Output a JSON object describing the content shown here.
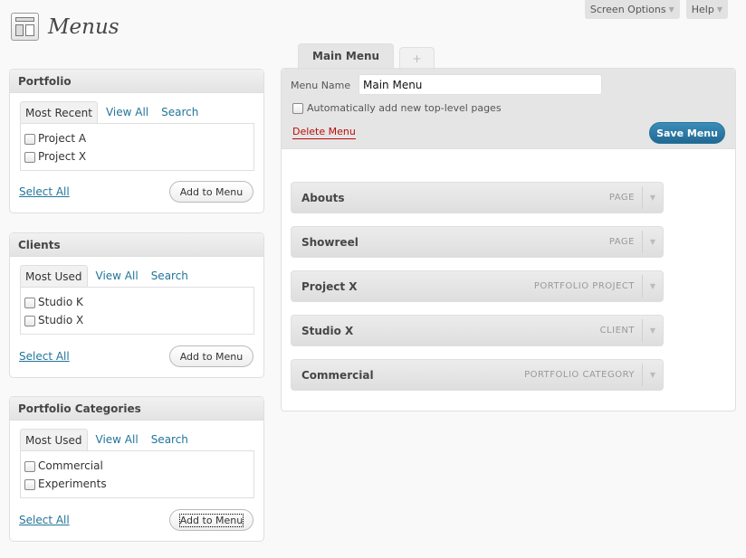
{
  "top": {
    "screen_options": "Screen Options",
    "help": "Help"
  },
  "page": {
    "title": "Menus"
  },
  "boxes": [
    {
      "title": "Portfolio",
      "tabs": [
        "Most Recent",
        "View All",
        "Search"
      ],
      "items": [
        "Project A",
        "Project X"
      ],
      "select_all": "Select All",
      "add_button": "Add to Menu"
    },
    {
      "title": "Clients",
      "tabs": [
        "Most Used",
        "View All",
        "Search"
      ],
      "items": [
        "Studio K",
        "Studio X"
      ],
      "select_all": "Select All",
      "add_button": "Add to Menu"
    },
    {
      "title": "Portfolio Categories",
      "tabs": [
        "Most Used",
        "View All",
        "Search"
      ],
      "items": [
        "Commercial",
        "Experiments"
      ],
      "select_all": "Select All",
      "add_button": "Add to Menu"
    }
  ],
  "editor": {
    "active_tab": "Main Menu",
    "add_tab": "+",
    "menu_name_label": "Menu Name",
    "menu_name_value": "Main Menu",
    "auto_add_label": "Automatically add new top-level pages",
    "delete_label": "Delete Menu",
    "save_label": "Save Menu",
    "items": [
      {
        "title": "Abouts",
        "type": "PAGE"
      },
      {
        "title": "Showreel",
        "type": "PAGE"
      },
      {
        "title": "Project X",
        "type": "PORTFOLIO PROJECT"
      },
      {
        "title": "Studio X",
        "type": "CLIENT"
      },
      {
        "title": "Commercial",
        "type": "PORTFOLIO CATEGORY"
      }
    ]
  },
  "colors": {
    "link": "#21759b",
    "save_button": "#21759b",
    "delete": "#bc0b0b"
  }
}
